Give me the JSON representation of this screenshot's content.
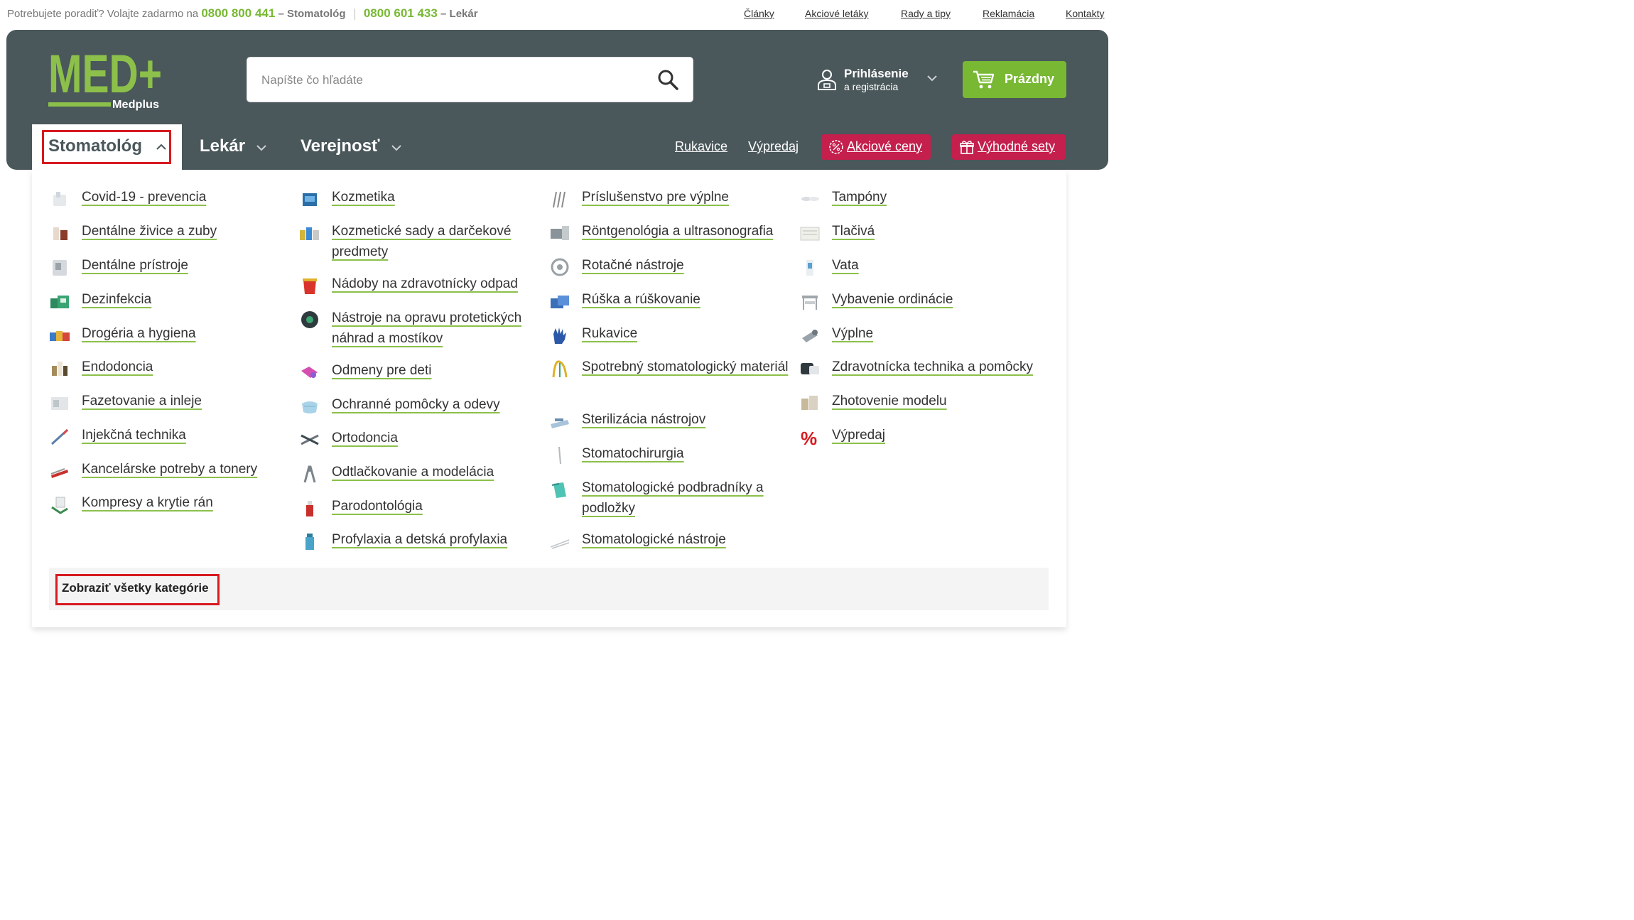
{
  "topbar": {
    "help_text": "Potrebujete poradiť? Volajte zadarmo na",
    "phone1": "0800 800 441",
    "phone1_label": "– Stomatológ",
    "phone2": "0800 601 433",
    "phone2_label": "– Lekár",
    "links": [
      "Články",
      "Akciové letáky",
      "Rady a tipy",
      "Reklamácia",
      "Kontakty"
    ]
  },
  "logo": {
    "text": "MED+",
    "subtitle": "Medplus"
  },
  "search": {
    "placeholder": "Napíšte čo hľadáte"
  },
  "account": {
    "title": "Prihlásenie",
    "subtitle": "a registrácia"
  },
  "cart": {
    "label": "Prázdny"
  },
  "nav": {
    "tabs": [
      "Stomatológ",
      "Lekár",
      "Verejnosť"
    ],
    "links": [
      "Rukavice",
      "Výpredaj"
    ],
    "promo": [
      "Akciové ceny",
      "Výhodné sety"
    ]
  },
  "categories": {
    "col1": [
      "Covid-19 - prevencia",
      "Dentálne živice a zuby",
      "Dentálne prístroje",
      "Dezinfekcia",
      "Drogéria a hygiena",
      "Endodoncia",
      "Fazetovanie a inleje",
      "Injekčná technika",
      "Kancelárske potreby a tonery",
      "Kompresy a krytie rán"
    ],
    "col2": [
      "Kozmetika",
      "Kozmetické sady a darčekové predmety",
      "Nádoby na zdravotnícky odpad",
      "Nástroje na opravu protetických náhrad a mostíkov",
      "Odmeny pre deti",
      "Ochranné pomôcky a odevy",
      "Ortodoncia",
      "Odtlačkovanie a modelácia",
      "Parodontológia",
      "Profylaxia a detská profylaxia"
    ],
    "col3": [
      "Príslušenstvo pre výplne",
      "Röntgenológia a ultrasonografia",
      "Rotačné nástroje",
      "Rúška a rúškovanie",
      "Rukavice",
      "Spotrebný stomatologický materiál",
      "Sterilizácia nástrojov",
      "Stomatochirurgia",
      "Stomatologické podbradníky a podložky",
      "Stomatologické nástroje"
    ],
    "col4": [
      "Tampóny",
      "Tlačivá",
      "Vata",
      "Vybavenie ordinácie",
      "Výplne",
      "Zdravotnícka technika a pomôcky",
      "Zhotovenie modelu",
      "Výpredaj"
    ]
  },
  "show_all": "Zobraziť všetky kategórie",
  "colors": {
    "brand_green": "#78b833",
    "header_bg": "#4a575b",
    "promo": "#c41f4d",
    "highlight": "#d71920"
  }
}
